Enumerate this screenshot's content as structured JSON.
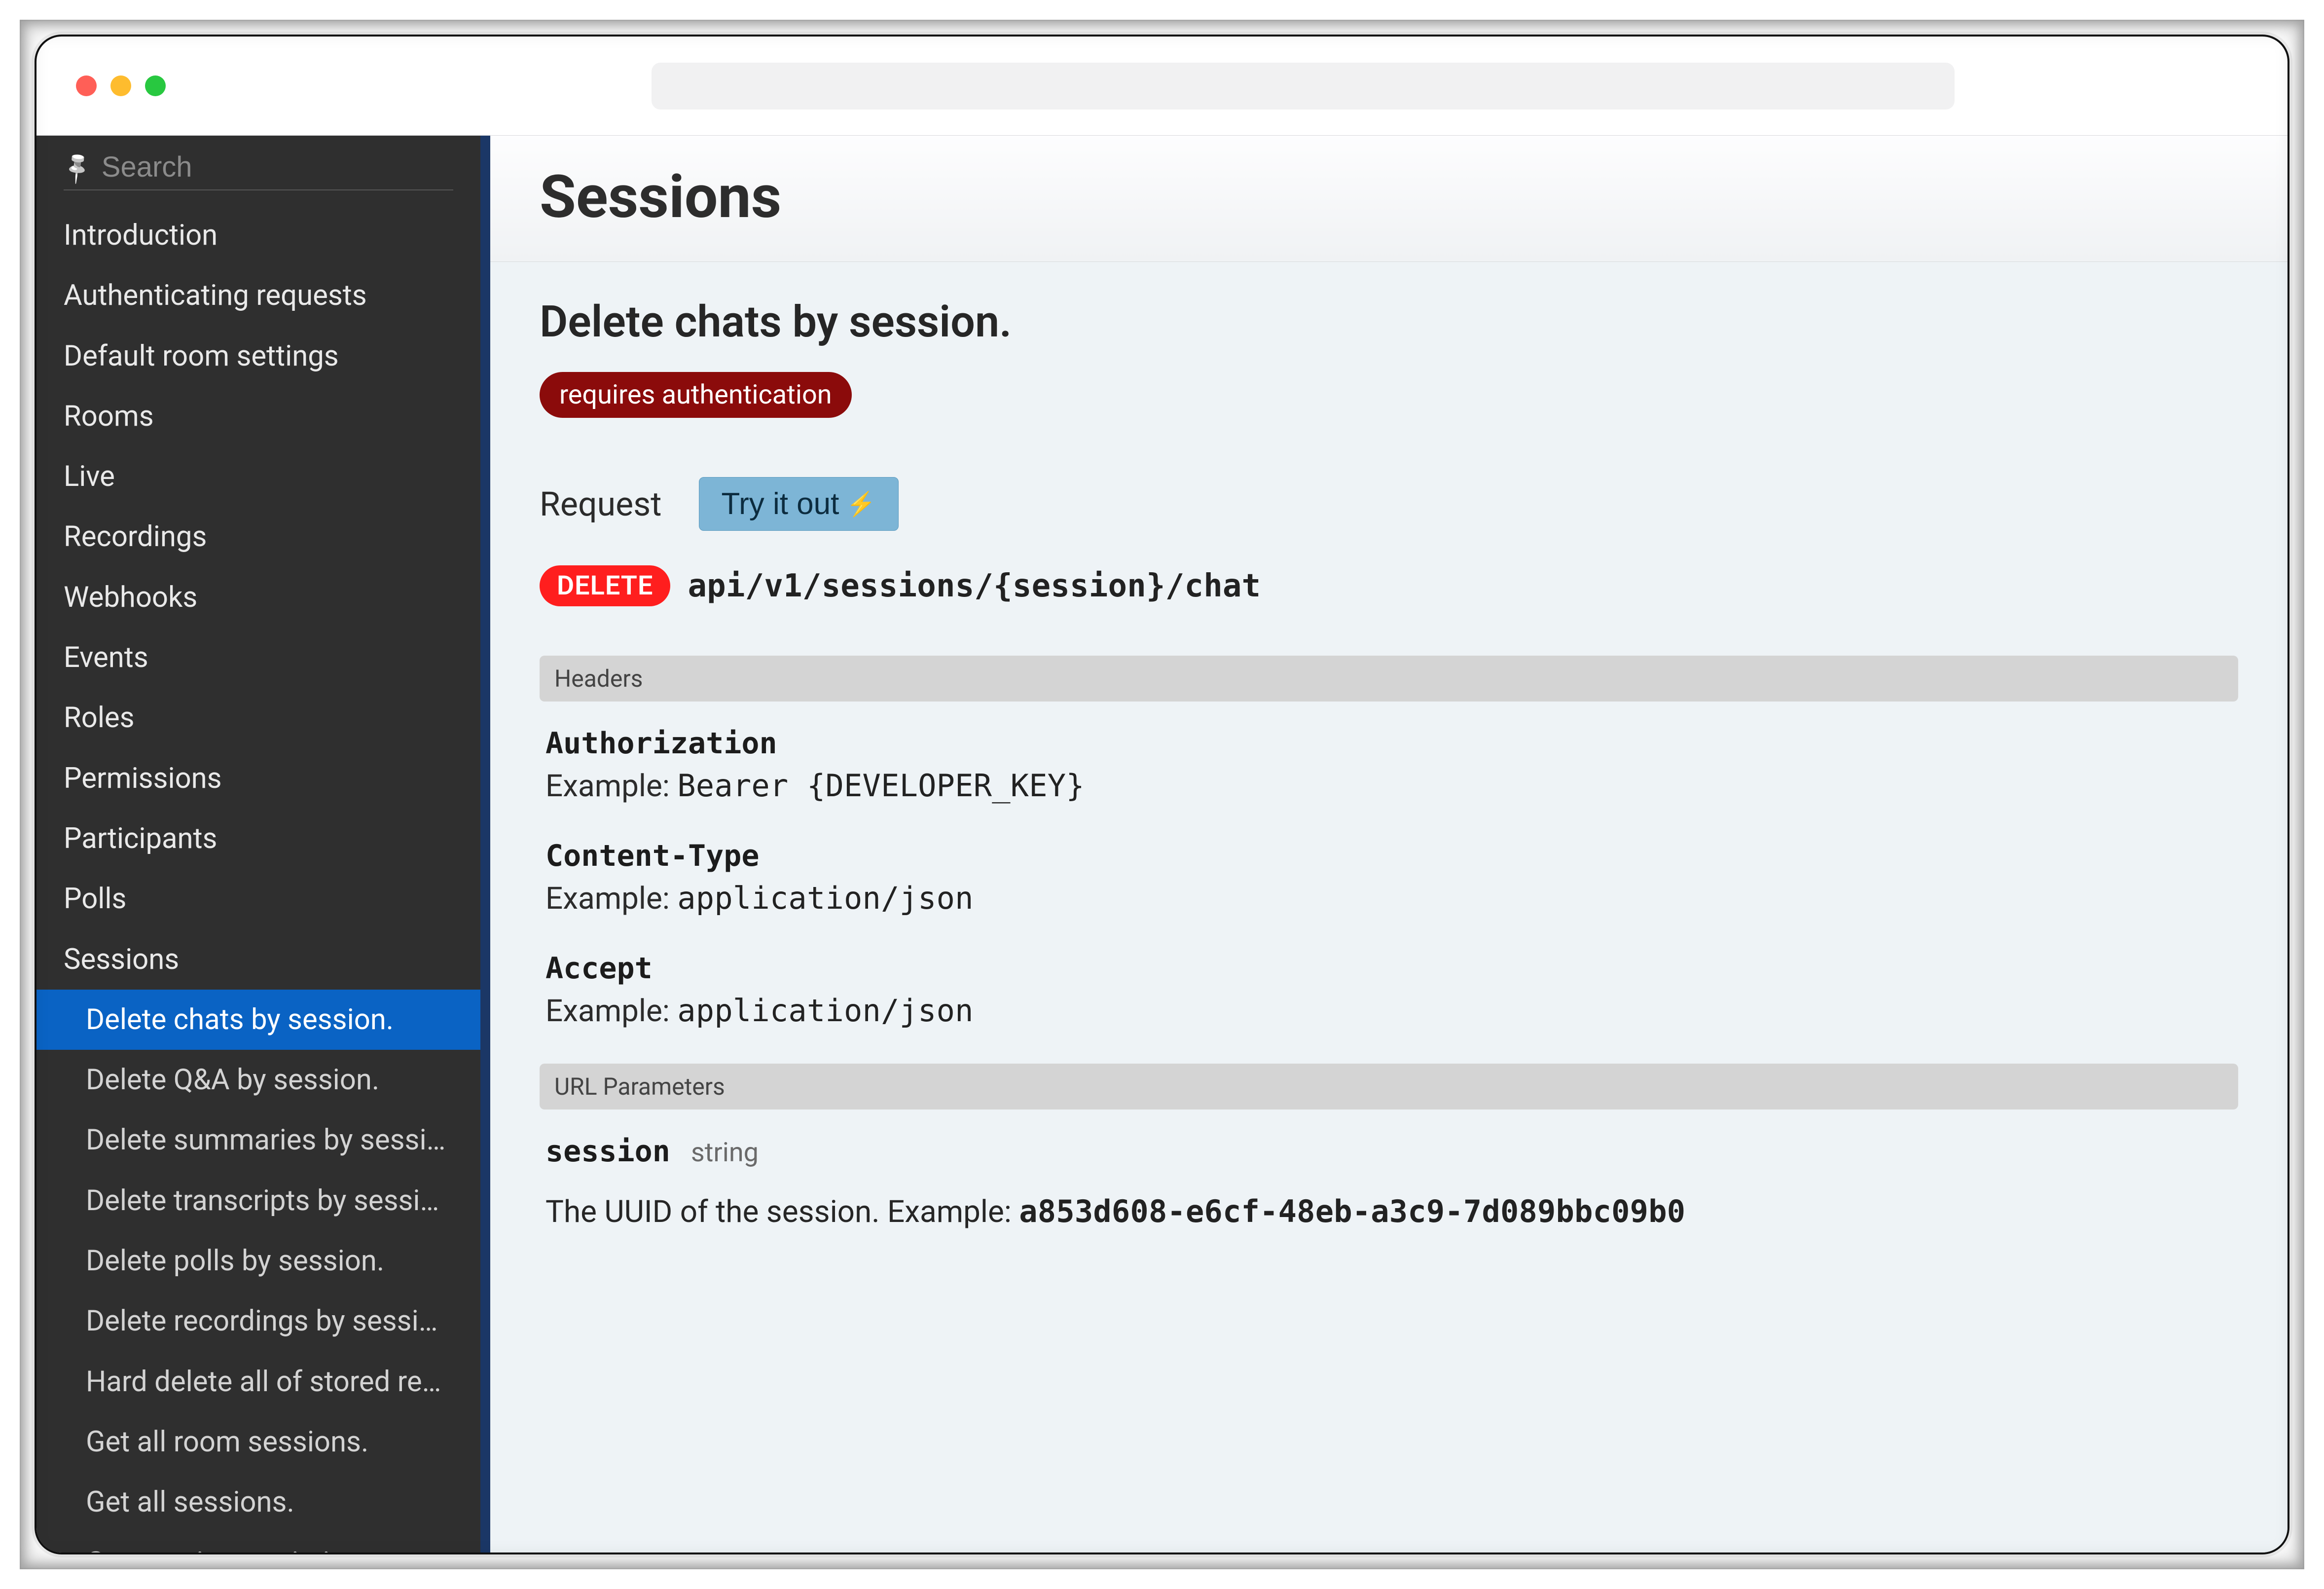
{
  "search": {
    "placeholder": "Search"
  },
  "sidebar": {
    "items": [
      {
        "label": "Introduction",
        "sub": false,
        "active": false
      },
      {
        "label": "Authenticating requests",
        "sub": false,
        "active": false
      },
      {
        "label": "Default room settings",
        "sub": false,
        "active": false
      },
      {
        "label": "Rooms",
        "sub": false,
        "active": false
      },
      {
        "label": "Live",
        "sub": false,
        "active": false
      },
      {
        "label": "Recordings",
        "sub": false,
        "active": false
      },
      {
        "label": "Webhooks",
        "sub": false,
        "active": false
      },
      {
        "label": "Events",
        "sub": false,
        "active": false
      },
      {
        "label": "Roles",
        "sub": false,
        "active": false
      },
      {
        "label": "Permissions",
        "sub": false,
        "active": false
      },
      {
        "label": "Participants",
        "sub": false,
        "active": false
      },
      {
        "label": "Polls",
        "sub": false,
        "active": false
      },
      {
        "label": "Sessions",
        "sub": false,
        "active": false
      },
      {
        "label": "Delete chats by session.",
        "sub": true,
        "active": true
      },
      {
        "label": "Delete Q&A by session.",
        "sub": true,
        "active": false
      },
      {
        "label": "Delete summaries by session.",
        "sub": true,
        "active": false
      },
      {
        "label": "Delete transcripts by session.",
        "sub": true,
        "active": false
      },
      {
        "label": "Delete polls by session.",
        "sub": true,
        "active": false
      },
      {
        "label": "Delete recordings by session.",
        "sub": true,
        "active": false
      },
      {
        "label": "Hard delete all of stored reso…",
        "sub": true,
        "active": false
      },
      {
        "label": "Get all room sessions.",
        "sub": true,
        "active": false
      },
      {
        "label": "Get all sessions.",
        "sub": true,
        "active": false
      },
      {
        "label": "Get session statistics.",
        "sub": true,
        "active": false
      }
    ]
  },
  "page": {
    "title": "Sessions",
    "heading": "Delete chats by session.",
    "auth_badge": "requires authentication",
    "request_label": "Request",
    "tryout_label": "Try it out",
    "method": "DELETE",
    "path": "api/v1/sessions/{session}/chat",
    "headers_label": "Headers",
    "headers": [
      {
        "name": "Authorization",
        "example_label": "Example:",
        "example_value": "Bearer {DEVELOPER_KEY}"
      },
      {
        "name": "Content-Type",
        "example_label": "Example:",
        "example_value": "application/json"
      },
      {
        "name": "Accept",
        "example_label": "Example:",
        "example_value": "application/json"
      }
    ],
    "url_params_label": "URL Parameters",
    "url_params": [
      {
        "name": "session",
        "type": "string",
        "description_prefix": "The UUID of the session. Example:",
        "example_value": "a853d608-e6cf-48eb-a3c9-7d089bbc09b0"
      }
    ]
  }
}
